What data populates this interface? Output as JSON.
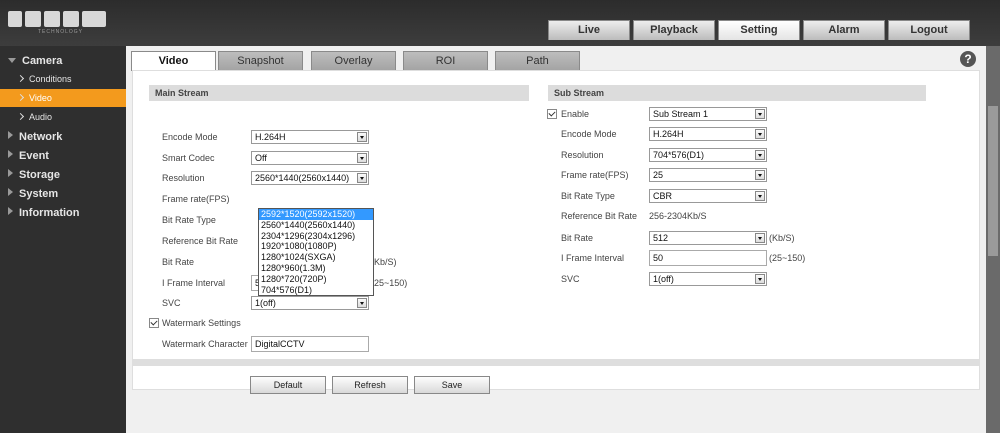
{
  "logo": {
    "subtitle": "TECHNOLOGY"
  },
  "nav": {
    "items": [
      "Live",
      "Playback",
      "Setting",
      "Alarm",
      "Logout"
    ],
    "active": "Setting"
  },
  "sidebar": {
    "camera": "Camera",
    "conditions": "Conditions",
    "video": "Video",
    "audio": "Audio",
    "network": "Network",
    "event": "Event",
    "storage": "Storage",
    "system": "System",
    "information": "Information"
  },
  "tabs": [
    "Video",
    "Snapshot",
    "Overlay",
    "ROI",
    "Path"
  ],
  "help": "?",
  "main_stream": {
    "title": "Main Stream",
    "labels": {
      "encode_mode": "Encode Mode",
      "smart_codec": "Smart Codec",
      "resolution": "Resolution",
      "frame_rate": "Frame rate(FPS)",
      "bit_rate_type": "Bit Rate Type",
      "ref_bit_rate": "Reference Bit Rate",
      "bit_rate": "Bit Rate",
      "i_frame": "I Frame Interval",
      "svc": "SVC"
    },
    "values": {
      "encode_mode": "H.264H",
      "smart_codec": "Off",
      "resolution": "2560*1440(2560x1440)",
      "i_frame": "50",
      "svc": "1(off)"
    },
    "bit_rate_unit": "(Kb/S)",
    "i_frame_range": "(25~150)",
    "resolution_options": [
      "2592*1520(2592x1520)",
      "2560*1440(2560x1440)",
      "2304*1296(2304x1296)",
      "1920*1080(1080P)",
      "1280*1024(SXGA)",
      "1280*960(1.3M)",
      "1280*720(720P)",
      "704*576(D1)"
    ],
    "resolution_highlight": "2592*1520(2592x1520)",
    "watermark_settings": "Watermark Settings",
    "watermark_character_label": "Watermark Character",
    "watermark_character": "DigitalCCTV"
  },
  "sub_stream": {
    "title": "Sub Stream",
    "enable_label": "Enable",
    "enable_value": "Sub Stream 1",
    "labels": {
      "encode_mode": "Encode Mode",
      "resolution": "Resolution",
      "frame_rate": "Frame rate(FPS)",
      "bit_rate_type": "Bit Rate Type",
      "ref_bit_rate": "Reference Bit Rate",
      "bit_rate": "Bit Rate",
      "i_frame": "I Frame Interval",
      "svc": "SVC"
    },
    "values": {
      "encode_mode": "H.264H",
      "resolution": "704*576(D1)",
      "frame_rate": "25",
      "bit_rate_type": "CBR",
      "ref_bit_rate": "256-2304Kb/S",
      "bit_rate": "512",
      "i_frame": "50",
      "svc": "1(off)"
    },
    "bit_rate_unit": "(Kb/S)",
    "i_frame_range": "(25~150)"
  },
  "buttons": {
    "default": "Default",
    "refresh": "Refresh",
    "save": "Save"
  }
}
